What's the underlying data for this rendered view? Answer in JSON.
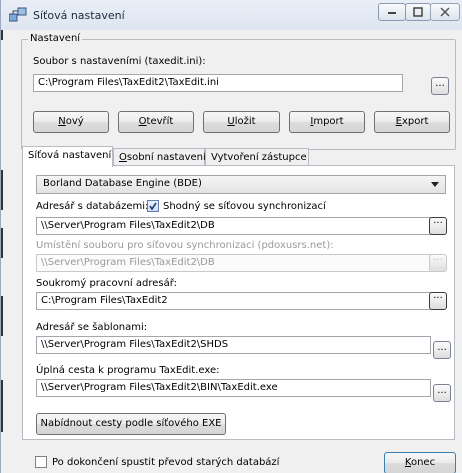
{
  "window": {
    "title": "Síťová nastavení",
    "controls": {
      "minimize": "minimize-icon",
      "maximize": "maximize-icon",
      "close": "close-icon"
    }
  },
  "settings_group": {
    "title": "Nastavení",
    "file_label": "Soubor s nastaveními (taxedit.ini):",
    "file_value": "C:\\Program Files\\TaxEdit2\\TaxEdit.ini",
    "browse": "...",
    "buttons": {
      "new_accel": "N",
      "new_rest": "ový",
      "open_accel": "O",
      "open_rest": "tevřít",
      "save_accel": "U",
      "save_rest": "ložit",
      "import_accel": "I",
      "import_rest": "mport",
      "export_accel": "E",
      "export_rest": "xport"
    }
  },
  "tabs": [
    {
      "label": "Síťová nastavení",
      "active": true
    },
    {
      "label_accel": "O",
      "label_rest": "sobní nastavení"
    },
    {
      "label": "Vytvoření zástupce"
    }
  ],
  "network": {
    "engine": "Borland Database Engine (BDE)",
    "db_dir_label": "Adresář s databázemi:",
    "same_as_sync_label": "Shodný se síťovou synchronizací",
    "same_as_sync_checked": true,
    "db_dir_value": "\\\\Server\\Program Files\\TaxEdit2\\DB",
    "sync_file_label": "Umístění souboru pro síťovou synchronizaci (pdoxusrs.net):",
    "sync_file_value": "\\\\Server\\Program Files\\TaxEdit2\\DB",
    "private_dir_label": "Soukromý pracovní adresář:",
    "private_dir_value": "C:\\Program Files\\TaxEdit2",
    "templates_dir_label": "Adresář se šablonami:",
    "templates_dir_value": "\\\\Server\\Program Files\\TaxEdit2\\SHDS",
    "program_path_label": "Úplná cesta k programu TaxEdit.exe:",
    "program_path_value": "\\\\Server\\Program Files\\TaxEdit2\\BIN\\TaxEdit.exe",
    "offer_paths_button": "Nabídnout cesty podle síťového EXE",
    "dots": "...",
    "ellipsis": "···"
  },
  "footer": {
    "convert_label": "Po dokončení spustit převod starých databází",
    "convert_checked": false,
    "end_accel": "K",
    "end_rest": "onec"
  }
}
